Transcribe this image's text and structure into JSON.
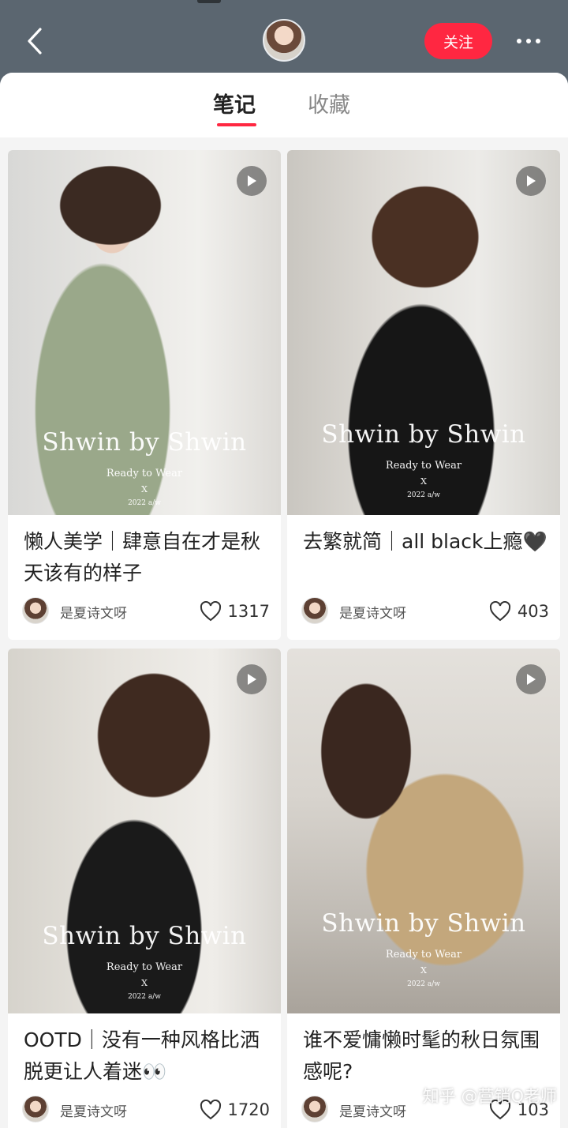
{
  "header": {
    "follow_label": "关注"
  },
  "tabs": [
    {
      "label": "笔记",
      "active": true
    },
    {
      "label": "收藏",
      "active": false
    }
  ],
  "cards": [
    {
      "title": "懒人美学｜肆意自在才是秋天该有的样子",
      "author": "是夏诗文呀",
      "likes": "1317",
      "brand_title": "Shwin by Shwin",
      "brand_sub": "Ready to Wear",
      "brand_x": "X",
      "brand_season": "2022 a/w"
    },
    {
      "title": "去繁就简｜all black上瘾🖤",
      "author": "是夏诗文呀",
      "likes": "403",
      "brand_title": "Shwin by Shwin",
      "brand_sub": "Ready to Wear",
      "brand_x": "X",
      "brand_season": "2022 a/w"
    },
    {
      "title": "OOTD｜没有一种风格比洒脱更让人着迷👀",
      "author": "是夏诗文呀",
      "likes": "1720",
      "brand_title": "Shwin by Shwin",
      "brand_sub": "Ready to Wear",
      "brand_x": "X",
      "brand_season": "2022 a/w"
    },
    {
      "title": "谁不爱慵懒时髦的秋日氛围感呢?",
      "author": "是夏诗文呀",
      "likes": "103",
      "brand_title": "Shwin by Shwin",
      "brand_sub": "Ready to Wear",
      "brand_x": "X",
      "brand_season": "2022 a/w"
    }
  ],
  "watermark": "知乎 @营销Q老师",
  "colors": {
    "accent": "#ff2741",
    "header_bg": "#5b6670"
  }
}
